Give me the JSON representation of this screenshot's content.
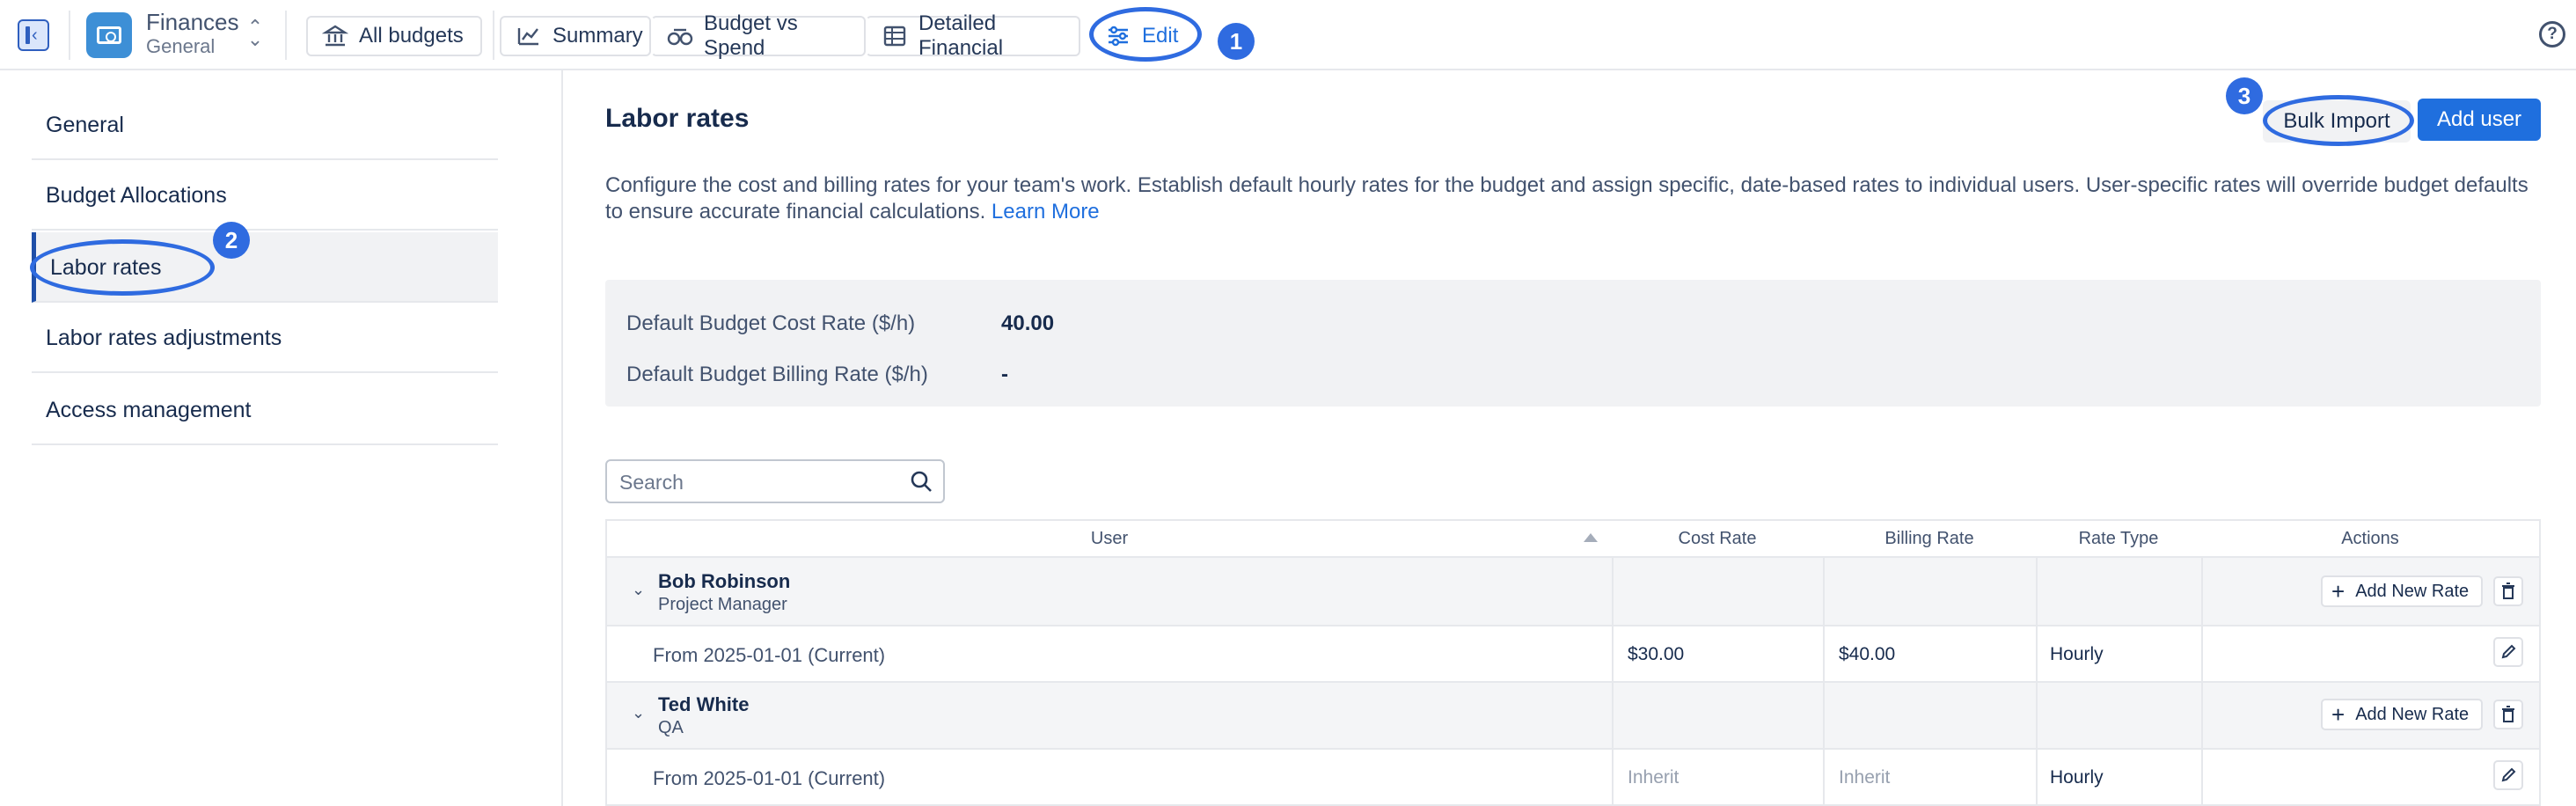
{
  "app": {
    "name": "Finances",
    "subtitle": "General"
  },
  "nav": {
    "all_budgets": "All budgets",
    "summary": "Summary",
    "budget_vs_spend": "Budget vs Spend",
    "detailed_financial": "Detailed Financial",
    "edit": "Edit"
  },
  "sidebar": {
    "items": [
      {
        "label": "General"
      },
      {
        "label": "Budget Allocations"
      },
      {
        "label": "Labor rates"
      },
      {
        "label": "Labor rates adjustments"
      },
      {
        "label": "Access management"
      }
    ]
  },
  "main": {
    "title": "Labor rates",
    "bulk_import": "Bulk Import",
    "add_user": "Add user",
    "description": "Configure the cost and billing rates for your team's work. Establish default hourly rates for the budget and assign specific, date-based rates to individual users. User-specific rates will override budget defaults to ensure accurate financial calculations.",
    "learn_more": "Learn More",
    "defaults": {
      "cost_label": "Default Budget Cost Rate ($/h)",
      "cost_value": "40.00",
      "billing_label": "Default Budget Billing Rate ($/h)",
      "billing_value": "-"
    },
    "search_placeholder": "Search"
  },
  "table": {
    "columns": [
      "User",
      "Cost Rate",
      "Billing Rate",
      "Rate Type",
      "Actions"
    ],
    "add_new_rate": "Add New Rate",
    "groups": [
      {
        "name": "Bob Robinson",
        "role": "Project Manager",
        "rate": {
          "period": "From 2025-01-01 (Current)",
          "cost": "$30.00",
          "billing": "$40.00",
          "type": "Hourly"
        }
      },
      {
        "name": "Ted White",
        "role": "QA",
        "rate": {
          "period": "From 2025-01-01 (Current)",
          "cost": "Inherit",
          "billing": "Inherit",
          "type": "Hourly"
        }
      }
    ]
  },
  "annotations": {
    "one": "1",
    "two": "2",
    "three": "3"
  },
  "colors": {
    "accent": "#1f6fde",
    "annotation": "#2f6be0",
    "sidebar_active": "#1f4fa8"
  }
}
